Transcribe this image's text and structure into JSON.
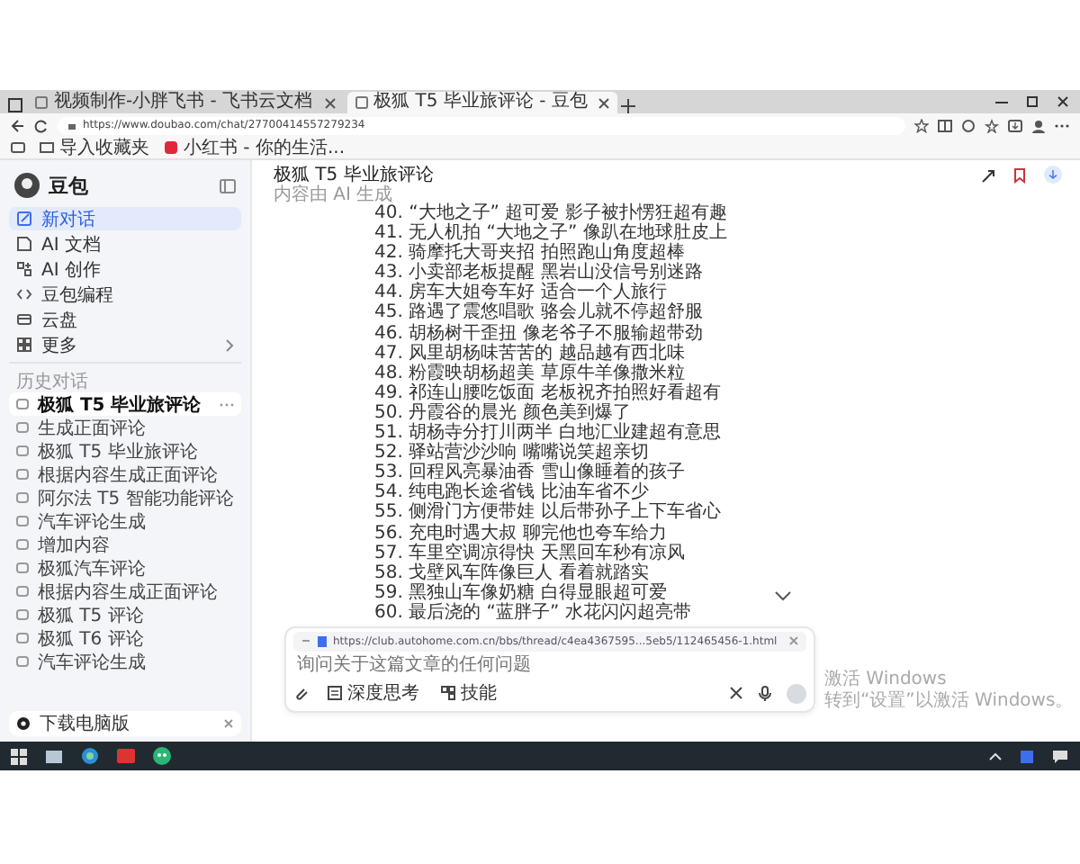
{
  "browser": {
    "tabs": [
      {
        "title": "视频制作-小胖飞书 - 飞书云文档",
        "selected": false
      },
      {
        "title": "极狐 T5 毕业旅评论 - 豆包",
        "selected": true
      }
    ],
    "address": "https://www.doubao.com/chat/27700414557279234",
    "bookmarks": [
      "导入收藏夹",
      "小红书 - 你的生活..."
    ]
  },
  "sidebar": {
    "app_name": "豆包",
    "nav": [
      {
        "label": "新对话",
        "selected": true
      },
      {
        "label": "AI 文档",
        "selected": false
      },
      {
        "label": "AI 创作",
        "selected": false
      },
      {
        "label": "豆包编程",
        "selected": false
      },
      {
        "label": "云盘",
        "selected": false
      },
      {
        "label": "更多",
        "selected": false
      }
    ],
    "history_heading": "历史对话",
    "history": [
      {
        "label": "极狐 T5 毕业旅评论",
        "selected": true
      },
      {
        "label": "生成正面评论",
        "selected": false
      },
      {
        "label": "极狐 T5 毕业旅评论",
        "selected": false
      },
      {
        "label": "根据内容生成正面评论",
        "selected": false
      },
      {
        "label": "阿尔法 T5 智能功能评论",
        "selected": false
      },
      {
        "label": "汽车评论生成",
        "selected": false
      },
      {
        "label": "增加内容",
        "selected": false
      },
      {
        "label": "极狐汽车评论",
        "selected": false
      },
      {
        "label": "根据内容生成正面评论",
        "selected": false
      },
      {
        "label": "极狐 T5 评论",
        "selected": false
      },
      {
        "label": "极狐 T6 评论",
        "selected": false
      },
      {
        "label": "汽车评论生成",
        "selected": false
      }
    ],
    "download": "下载电脑版"
  },
  "chat": {
    "title": "极狐 T5 毕业旅评论",
    "subtitle": "内容由 AI 生成",
    "lines": [
      "40. “大地之子” 超可爱 影子被扑愣狂超有趣",
      "41. 无人机拍 “大地之子” 像趴在地球肚皮上",
      "42. 骑摩托大哥夹招 拍照跑山角度超棒",
      "43. 小卖部老板提醒 黑岩山没信号别迷路",
      "44. 房车大姐夸车好 适合一个人旅行",
      "45. 路遇了震悠唱歌 骆会儿就不停超舒服",
      "46. 胡杨树干歪扭 像老爷子不服输超带劲",
      "47. 风里胡杨味苦苦的 越品越有西北味",
      "48. 粉霞映胡杨超美 草原牛羊像撒米粒",
      "49. 祁连山腰吃饭面 老板祝齐拍照好看超有",
      "50. 丹霞谷的晨光 颜色美到爆了",
      "51. 胡杨寺分打川两半 白地汇业建超有意思",
      "52. 驿站营沙沙响 嘴嘴说笑超亲切",
      "53. 回程风亮暴油香 雪山像睡着的孩子",
      "54. 纯电跑长途省钱 比油车省不少",
      "55. 侧滑门方便带娃 以后带孙子上下车省心",
      "56. 充电时遇大叔 聊完他也夸车给力",
      "57. 车里空调凉得快 天黑回车秒有凉风",
      "58. 戈壁风车阵像巨人 看着就踏实",
      "59. 黑独山车像奶糖 白得显眼超可爱",
      "60. 最后浇的 “蓝胖子” 水花闪闪超亮带"
    ],
    "attachment_url": "https://club.autohome.com.cn/bbs/thread/c4ea4367595...5eb5/112465456-1.html",
    "placeholder": "询问关于这篇文章的任何问题",
    "tools": [
      "深度思考",
      "技能"
    ]
  },
  "os": {
    "activation_title": "激活 Windows",
    "activation_hint": "转到“设置”以激活 Windows。"
  }
}
